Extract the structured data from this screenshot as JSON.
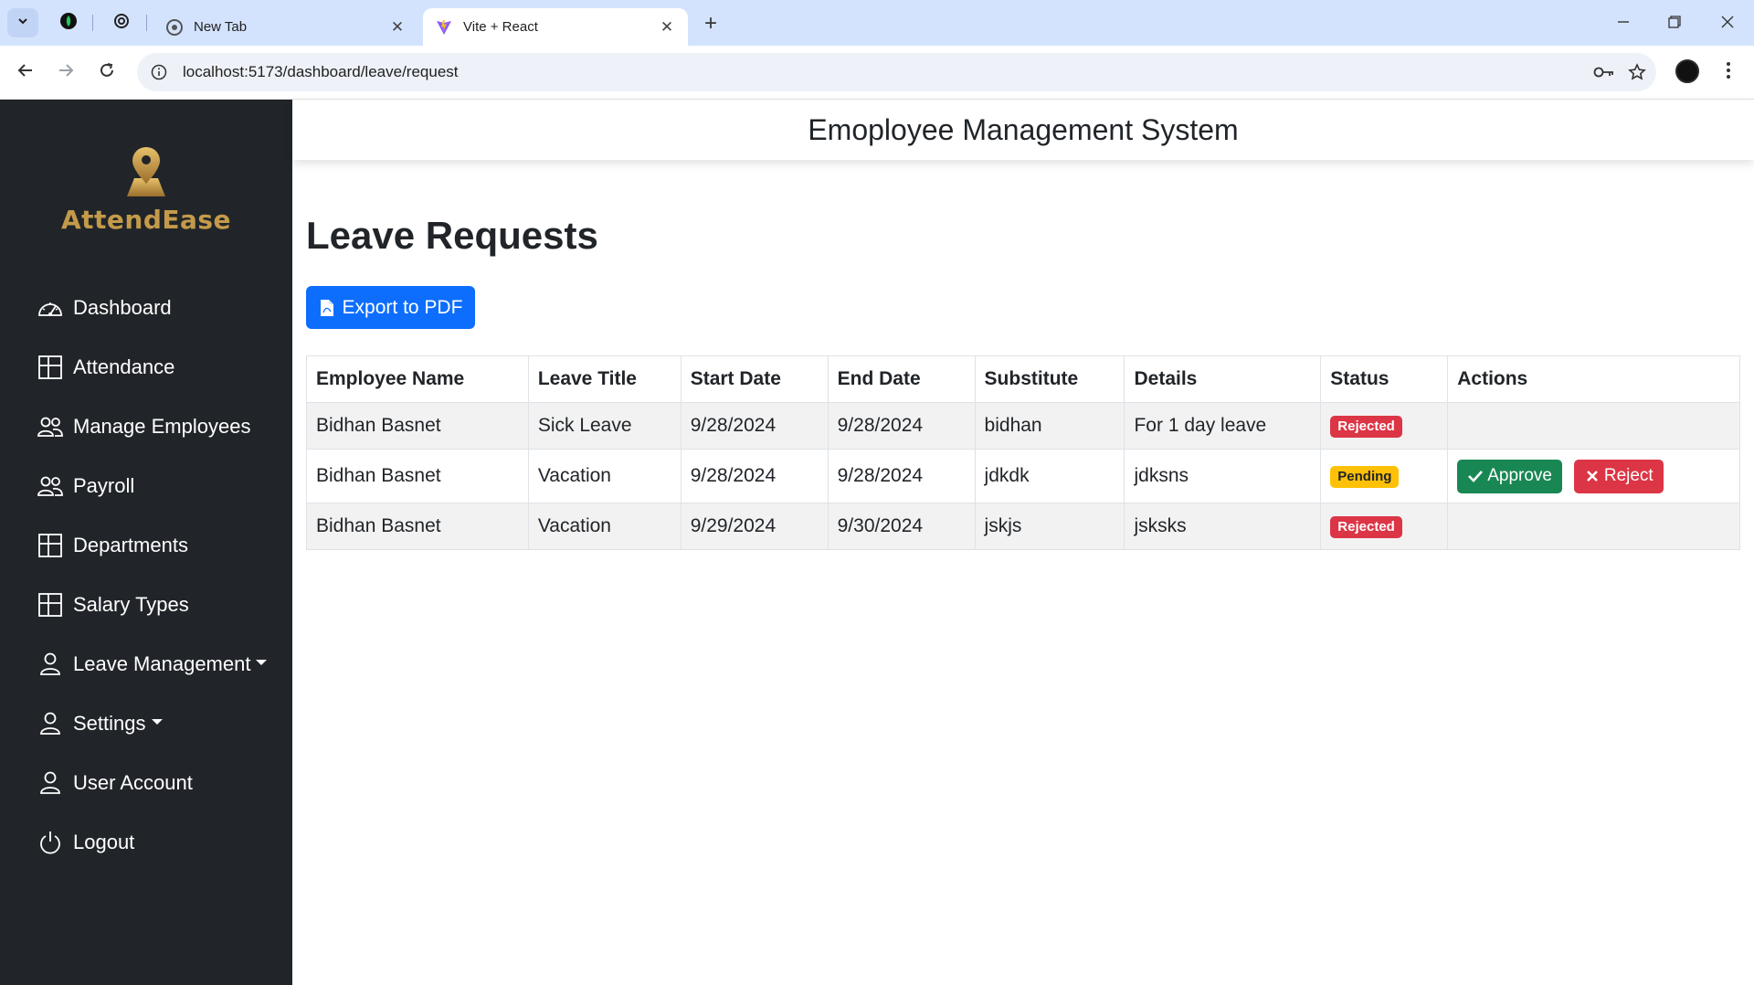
{
  "browser": {
    "tabs": [
      {
        "label": "New Tab",
        "active": false
      },
      {
        "label": "Vite + React",
        "active": true
      }
    ],
    "url": "localhost:5173/dashboard/leave/request"
  },
  "sidebar": {
    "brand": "AttendEase",
    "items": [
      {
        "label": "Dashboard",
        "icon": "speedometer-icon"
      },
      {
        "label": "Attendance",
        "icon": "layout-icon"
      },
      {
        "label": "Manage Employees",
        "icon": "people-icon"
      },
      {
        "label": "Payroll",
        "icon": "people-icon"
      },
      {
        "label": "Departments",
        "icon": "layout-icon"
      },
      {
        "label": "Salary Types",
        "icon": "layout-icon"
      },
      {
        "label": "Leave Management",
        "icon": "person-icon",
        "dropdown": true
      },
      {
        "label": "Settings",
        "icon": "person-icon",
        "dropdown": true
      },
      {
        "label": "User Account",
        "icon": "person-icon"
      },
      {
        "label": "Logout",
        "icon": "power-icon"
      }
    ]
  },
  "header": {
    "title": "Emoployee Management System"
  },
  "page": {
    "title": "Leave Requests",
    "export_label": "Export to PDF"
  },
  "table": {
    "columns": [
      "Employee Name",
      "Leave Title",
      "Start Date",
      "End Date",
      "Substitute",
      "Details",
      "Status",
      "Actions"
    ],
    "rows": [
      {
        "employee": "Bidhan Basnet",
        "title": "Sick Leave",
        "start": "9/28/2024",
        "end": "9/28/2024",
        "substitute": "bidhan",
        "details": "For 1 day leave",
        "status": "Rejected"
      },
      {
        "employee": "Bidhan Basnet",
        "title": "Vacation",
        "start": "9/28/2024",
        "end": "9/28/2024",
        "substitute": "jdkdk",
        "details": "jdksns",
        "status": "Pending",
        "approve_label": "Approve",
        "reject_label": "Reject"
      },
      {
        "employee": "Bidhan Basnet",
        "title": "Vacation",
        "start": "9/29/2024",
        "end": "9/30/2024",
        "substitute": "jskjs",
        "details": "jsksks",
        "status": "Rejected"
      }
    ]
  },
  "colors": {
    "sidebar_bg": "#212529",
    "primary": "#0d6efd",
    "success": "#198754",
    "danger": "#dc3545",
    "warning": "#ffc107",
    "brand_gold": "#c49a4a"
  }
}
